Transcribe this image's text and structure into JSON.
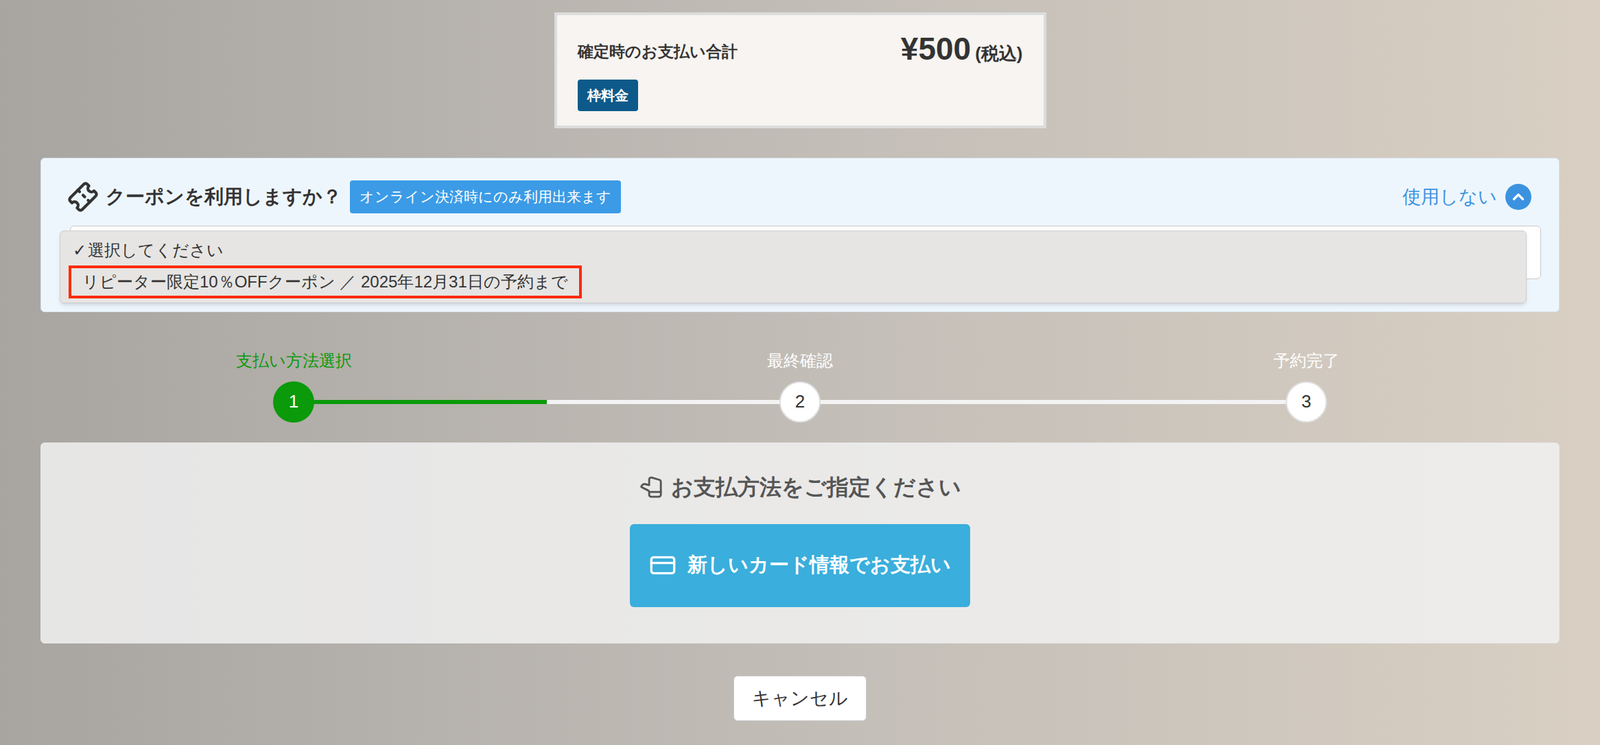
{
  "summary": {
    "label": "確定時のお支払い合計",
    "amount": "¥500",
    "tax_note": "(税込)",
    "badge": "枠料金"
  },
  "coupon": {
    "title": "クーポンを利用しますか？",
    "badge": "オンライン決済時にのみ利用出来ます",
    "toggle": "使用しない",
    "expanded": true,
    "dropdown_open": true,
    "check_mark": "✓",
    "options": [
      {
        "label": "選択してください",
        "checked": true,
        "highlighted": false
      },
      {
        "label": "リピーター限定10％OFFクーポン ／ 2025年12月31日の予約まで",
        "checked": false,
        "highlighted": true
      }
    ]
  },
  "steps": [
    {
      "number": "1",
      "label": "支払い方法選択",
      "selected": true
    },
    {
      "number": "2",
      "label": "最終確認",
      "selected": false
    },
    {
      "number": "3",
      "label": "予約完了",
      "selected": false
    }
  ],
  "progress": {
    "level": 0.25
  },
  "payment": {
    "title": "お支払方法をご指定ください",
    "button": "新しいカード情報でお支払い"
  },
  "cancel": "キャンセル"
}
